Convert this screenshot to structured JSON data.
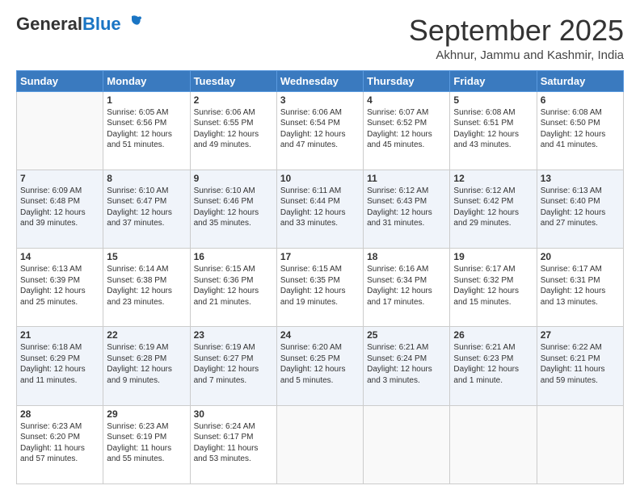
{
  "header": {
    "logo_general": "General",
    "logo_blue": "Blue",
    "month_title": "September 2025",
    "location": "Akhnur, Jammu and Kashmir, India"
  },
  "weekdays": [
    "Sunday",
    "Monday",
    "Tuesday",
    "Wednesday",
    "Thursday",
    "Friday",
    "Saturday"
  ],
  "weeks": [
    [
      {
        "day": "",
        "sunrise": "",
        "sunset": "",
        "daylight": ""
      },
      {
        "day": "1",
        "sunrise": "Sunrise: 6:05 AM",
        "sunset": "Sunset: 6:56 PM",
        "daylight": "Daylight: 12 hours and 51 minutes."
      },
      {
        "day": "2",
        "sunrise": "Sunrise: 6:06 AM",
        "sunset": "Sunset: 6:55 PM",
        "daylight": "Daylight: 12 hours and 49 minutes."
      },
      {
        "day": "3",
        "sunrise": "Sunrise: 6:06 AM",
        "sunset": "Sunset: 6:54 PM",
        "daylight": "Daylight: 12 hours and 47 minutes."
      },
      {
        "day": "4",
        "sunrise": "Sunrise: 6:07 AM",
        "sunset": "Sunset: 6:52 PM",
        "daylight": "Daylight: 12 hours and 45 minutes."
      },
      {
        "day": "5",
        "sunrise": "Sunrise: 6:08 AM",
        "sunset": "Sunset: 6:51 PM",
        "daylight": "Daylight: 12 hours and 43 minutes."
      },
      {
        "day": "6",
        "sunrise": "Sunrise: 6:08 AM",
        "sunset": "Sunset: 6:50 PM",
        "daylight": "Daylight: 12 hours and 41 minutes."
      }
    ],
    [
      {
        "day": "7",
        "sunrise": "Sunrise: 6:09 AM",
        "sunset": "Sunset: 6:48 PM",
        "daylight": "Daylight: 12 hours and 39 minutes."
      },
      {
        "day": "8",
        "sunrise": "Sunrise: 6:10 AM",
        "sunset": "Sunset: 6:47 PM",
        "daylight": "Daylight: 12 hours and 37 minutes."
      },
      {
        "day": "9",
        "sunrise": "Sunrise: 6:10 AM",
        "sunset": "Sunset: 6:46 PM",
        "daylight": "Daylight: 12 hours and 35 minutes."
      },
      {
        "day": "10",
        "sunrise": "Sunrise: 6:11 AM",
        "sunset": "Sunset: 6:44 PM",
        "daylight": "Daylight: 12 hours and 33 minutes."
      },
      {
        "day": "11",
        "sunrise": "Sunrise: 6:12 AM",
        "sunset": "Sunset: 6:43 PM",
        "daylight": "Daylight: 12 hours and 31 minutes."
      },
      {
        "day": "12",
        "sunrise": "Sunrise: 6:12 AM",
        "sunset": "Sunset: 6:42 PM",
        "daylight": "Daylight: 12 hours and 29 minutes."
      },
      {
        "day": "13",
        "sunrise": "Sunrise: 6:13 AM",
        "sunset": "Sunset: 6:40 PM",
        "daylight": "Daylight: 12 hours and 27 minutes."
      }
    ],
    [
      {
        "day": "14",
        "sunrise": "Sunrise: 6:13 AM",
        "sunset": "Sunset: 6:39 PM",
        "daylight": "Daylight: 12 hours and 25 minutes."
      },
      {
        "day": "15",
        "sunrise": "Sunrise: 6:14 AM",
        "sunset": "Sunset: 6:38 PM",
        "daylight": "Daylight: 12 hours and 23 minutes."
      },
      {
        "day": "16",
        "sunrise": "Sunrise: 6:15 AM",
        "sunset": "Sunset: 6:36 PM",
        "daylight": "Daylight: 12 hours and 21 minutes."
      },
      {
        "day": "17",
        "sunrise": "Sunrise: 6:15 AM",
        "sunset": "Sunset: 6:35 PM",
        "daylight": "Daylight: 12 hours and 19 minutes."
      },
      {
        "day": "18",
        "sunrise": "Sunrise: 6:16 AM",
        "sunset": "Sunset: 6:34 PM",
        "daylight": "Daylight: 12 hours and 17 minutes."
      },
      {
        "day": "19",
        "sunrise": "Sunrise: 6:17 AM",
        "sunset": "Sunset: 6:32 PM",
        "daylight": "Daylight: 12 hours and 15 minutes."
      },
      {
        "day": "20",
        "sunrise": "Sunrise: 6:17 AM",
        "sunset": "Sunset: 6:31 PM",
        "daylight": "Daylight: 12 hours and 13 minutes."
      }
    ],
    [
      {
        "day": "21",
        "sunrise": "Sunrise: 6:18 AM",
        "sunset": "Sunset: 6:29 PM",
        "daylight": "Daylight: 12 hours and 11 minutes."
      },
      {
        "day": "22",
        "sunrise": "Sunrise: 6:19 AM",
        "sunset": "Sunset: 6:28 PM",
        "daylight": "Daylight: 12 hours and 9 minutes."
      },
      {
        "day": "23",
        "sunrise": "Sunrise: 6:19 AM",
        "sunset": "Sunset: 6:27 PM",
        "daylight": "Daylight: 12 hours and 7 minutes."
      },
      {
        "day": "24",
        "sunrise": "Sunrise: 6:20 AM",
        "sunset": "Sunset: 6:25 PM",
        "daylight": "Daylight: 12 hours and 5 minutes."
      },
      {
        "day": "25",
        "sunrise": "Sunrise: 6:21 AM",
        "sunset": "Sunset: 6:24 PM",
        "daylight": "Daylight: 12 hours and 3 minutes."
      },
      {
        "day": "26",
        "sunrise": "Sunrise: 6:21 AM",
        "sunset": "Sunset: 6:23 PM",
        "daylight": "Daylight: 12 hours and 1 minute."
      },
      {
        "day": "27",
        "sunrise": "Sunrise: 6:22 AM",
        "sunset": "Sunset: 6:21 PM",
        "daylight": "Daylight: 11 hours and 59 minutes."
      }
    ],
    [
      {
        "day": "28",
        "sunrise": "Sunrise: 6:23 AM",
        "sunset": "Sunset: 6:20 PM",
        "daylight": "Daylight: 11 hours and 57 minutes."
      },
      {
        "day": "29",
        "sunrise": "Sunrise: 6:23 AM",
        "sunset": "Sunset: 6:19 PM",
        "daylight": "Daylight: 11 hours and 55 minutes."
      },
      {
        "day": "30",
        "sunrise": "Sunrise: 6:24 AM",
        "sunset": "Sunset: 6:17 PM",
        "daylight": "Daylight: 11 hours and 53 minutes."
      },
      {
        "day": "",
        "sunrise": "",
        "sunset": "",
        "daylight": ""
      },
      {
        "day": "",
        "sunrise": "",
        "sunset": "",
        "daylight": ""
      },
      {
        "day": "",
        "sunrise": "",
        "sunset": "",
        "daylight": ""
      },
      {
        "day": "",
        "sunrise": "",
        "sunset": "",
        "daylight": ""
      }
    ]
  ]
}
